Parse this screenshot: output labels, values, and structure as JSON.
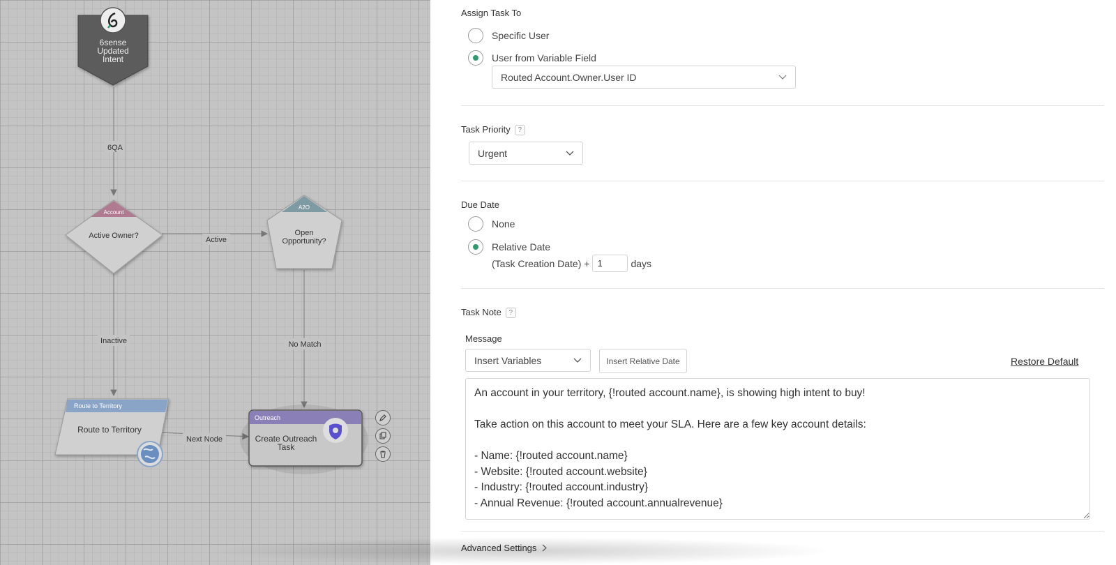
{
  "flow": {
    "trigger": {
      "line1": "6sense",
      "line2": "Updated",
      "line3": "Intent"
    },
    "edges": {
      "sixqa": "6QA",
      "active": "Active",
      "inactive": "Inactive",
      "no_match": "No Match",
      "next_node": "Next Node"
    },
    "active_owner": {
      "tag": "Account",
      "label": "Active Owner?"
    },
    "open_opp": {
      "tag": "A2O",
      "line1": "Open",
      "line2": "Opportunity?"
    },
    "route": {
      "tag": "Route to Territory",
      "label": "Route to Territory"
    },
    "outreach": {
      "tag": "Outreach",
      "line1": "Create Outreach",
      "line2": "Task"
    }
  },
  "panel": {
    "assign": {
      "title": "Assign Task To",
      "specific_user": "Specific User",
      "variable_field": "User from Variable Field",
      "selected_field": "Routed Account.Owner.User ID"
    },
    "priority": {
      "title": "Task Priority",
      "help": "?",
      "value": "Urgent"
    },
    "due_date": {
      "title": "Due Date",
      "none": "None",
      "relative": "Relative Date",
      "prefix": "(Task Creation Date) +",
      "days_value": "1",
      "suffix": "days"
    },
    "task_note": {
      "title": "Task Note",
      "help": "?",
      "message_label": "Message",
      "insert_variables": "Insert Variables",
      "insert_relative_date": "Insert Relative Date",
      "restore_default": "Restore Default",
      "message": "An account in your territory, {!routed account.name}, is showing high intent to buy!\n\nTake action on this account to meet your SLA. Here are a few key account details:\n\n- Name: {!routed account.name}\n- Website: {!routed account.website}\n- Industry: {!routed account.industry}\n- Annual Revenue: {!routed account.annualrevenue}"
    },
    "advanced": "Advanced Settings"
  },
  "colors": {
    "accent_green": "#2f9a6c",
    "account_tag": "#b07a90",
    "a2o_tag": "#7e9aa2",
    "route_tag": "#8aa4c8",
    "outreach_tag": "#8b7fb8",
    "outreach_icon": "#5a4fcf"
  }
}
